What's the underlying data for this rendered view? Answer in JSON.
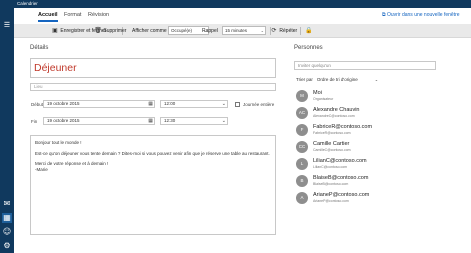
{
  "window": {
    "title": "Calendrier"
  },
  "tabs": [
    {
      "label": "Accueil",
      "active": true
    },
    {
      "label": "Format",
      "active": false
    },
    {
      "label": "Révision",
      "active": false
    }
  ],
  "open_new_window": "Ouvrir dans une nouvelle fenêtre",
  "toolbar": {
    "save_close": "Enregistrer et fermer",
    "delete": "Supprimer",
    "show_as_label": "Afficher comme",
    "show_as_value": "Occupé(e)",
    "reminder_label": "Rappel",
    "reminder_value": "15 minutes",
    "repeat": "Répéter"
  },
  "details": {
    "heading": "Détails",
    "subject": "Déjeuner",
    "location_placeholder": "Lieu",
    "start_label": "Début",
    "start_date": "19 octobre 2015",
    "start_time": "12:00",
    "all_day_label": "Journée entière",
    "end_label": "Fin",
    "end_date": "19 octobre 2015",
    "end_time": "12:30",
    "body": {
      "line1": "Bonjour tout le monde !",
      "line2": "Est-ce qu'on déjeuner vous tente demain ? Dites-moi si vous pouvez venir afin que je réserve une table au restaurant.",
      "line3": "Merci de votre réponse et à demain !",
      "line4": "-Marie"
    }
  },
  "people": {
    "heading": "Personnes",
    "search_placeholder": "Inviter quelqu'un",
    "sort_label": "Trier par",
    "sort_value": "Ordre de tri d'origine",
    "list": [
      {
        "initials": "M",
        "name": "Moi",
        "email": "Organisateur"
      },
      {
        "initials": "AC",
        "name": "Alexandre Chauvin",
        "email": "AlexandreC@contoso.com"
      },
      {
        "initials": "F",
        "name": "FabriceR@contoso.com",
        "email": "FabriceR@contoso.com"
      },
      {
        "initials": "CC",
        "name": "Camille Cartier",
        "email": "CamilleC@contoso.com"
      },
      {
        "initials": "L",
        "name": "LilianC@contoso.com",
        "email": "LilianC@contoso.com"
      },
      {
        "initials": "B",
        "name": "BlaiseB@contoso.com",
        "email": "BlaiseB@contoso.com"
      },
      {
        "initials": "A",
        "name": "ArianeP@contoso.com",
        "email": "ArianeP@contoso.com"
      }
    ]
  },
  "icons": {
    "save": "save-icon",
    "delete": "trash-icon",
    "repeat": "repeat-icon",
    "lock": "lock-icon",
    "calendar": "calendar-icon",
    "clock": "clock-icon",
    "mail": "mail-icon",
    "calendar_nav": "calendar-nav-icon",
    "people_nav": "people-nav-icon",
    "settings": "gear-icon"
  },
  "colors": {
    "accent": "#1565c0",
    "title_bar": "#10395e",
    "subject_text": "#c0392b"
  }
}
